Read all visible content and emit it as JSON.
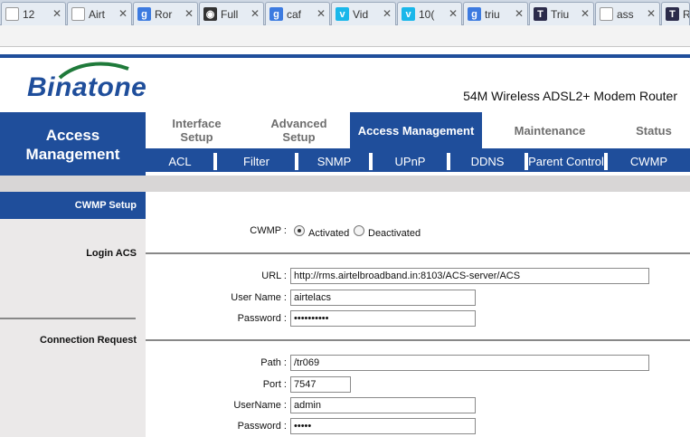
{
  "browser": {
    "tabs": [
      {
        "title": "12",
        "icon": "page-icon",
        "icon_color": "#cfd8e4"
      },
      {
        "title": "Airt",
        "icon": "page-icon",
        "icon_color": "#cfd8e4"
      },
      {
        "title": "Ror",
        "icon": "google-icon",
        "icon_color": "#3d7be0",
        "glyph": "g"
      },
      {
        "title": "Full",
        "icon": "eye-icon",
        "icon_color": "#333333",
        "glyph": "◉"
      },
      {
        "title": "caf",
        "icon": "google-icon",
        "icon_color": "#3d7be0",
        "glyph": "g"
      },
      {
        "title": "Vid",
        "icon": "vimeo-icon",
        "icon_color": "#1ab7ea",
        "glyph": "v"
      },
      {
        "title": "10(",
        "icon": "vimeo-icon",
        "icon_color": "#1ab7ea",
        "glyph": "v"
      },
      {
        "title": "triu",
        "icon": "google-icon",
        "icon_color": "#3d7be0",
        "glyph": "g"
      },
      {
        "title": "Triu",
        "icon": "t-icon",
        "icon_color": "#2b2b4a",
        "glyph": "T"
      },
      {
        "title": "ass",
        "icon": "page-icon",
        "icon_color": "#cfd8e4"
      },
      {
        "title": "Re",
        "icon": "t-icon",
        "icon_color": "#2b2b4a",
        "glyph": "T"
      }
    ]
  },
  "header": {
    "brand": "Binatone",
    "model": "54M Wireless ADSL2+ Modem Router"
  },
  "nav": {
    "section_title_line1": "Access",
    "section_title_line2": "Management",
    "top": [
      {
        "line1": "Interface",
        "line2": "Setup"
      },
      {
        "line1": "Advanced",
        "line2": "Setup"
      },
      {
        "line1": "Access Management",
        "line2": ""
      },
      {
        "line1": "Maintenance",
        "line2": ""
      },
      {
        "line1": "Status",
        "line2": ""
      }
    ],
    "sub": [
      "ACL",
      "Filter",
      "SNMP",
      "UPnP",
      "DDNS",
      "Parent Control",
      "CWMP"
    ]
  },
  "left": {
    "heading": "CWMP Setup",
    "login_acs": "Login ACS",
    "connection_request": "Connection Request"
  },
  "form": {
    "cwmp_label": "CWMP :",
    "activated": "Activated",
    "deactivated": "Deactivated",
    "url_label": "URL :",
    "url_value": "http://rms.airtelbroadband.in:8103/ACS-server/ACS",
    "username_label": "User Name :",
    "username_value": "airtelacs",
    "password_label": "Password :",
    "password_value": "••••••••••",
    "path_label": "Path :",
    "path_value": "/tr069",
    "port_label": "Port :",
    "port_value": "7547",
    "cr_username_label": "UserName :",
    "cr_username_value": "admin",
    "cr_password_label": "Password :",
    "cr_password_value": "•••••"
  },
  "colors": {
    "brand_blue": "#1f4e9b",
    "panel_grey": "#ebe9e9"
  }
}
